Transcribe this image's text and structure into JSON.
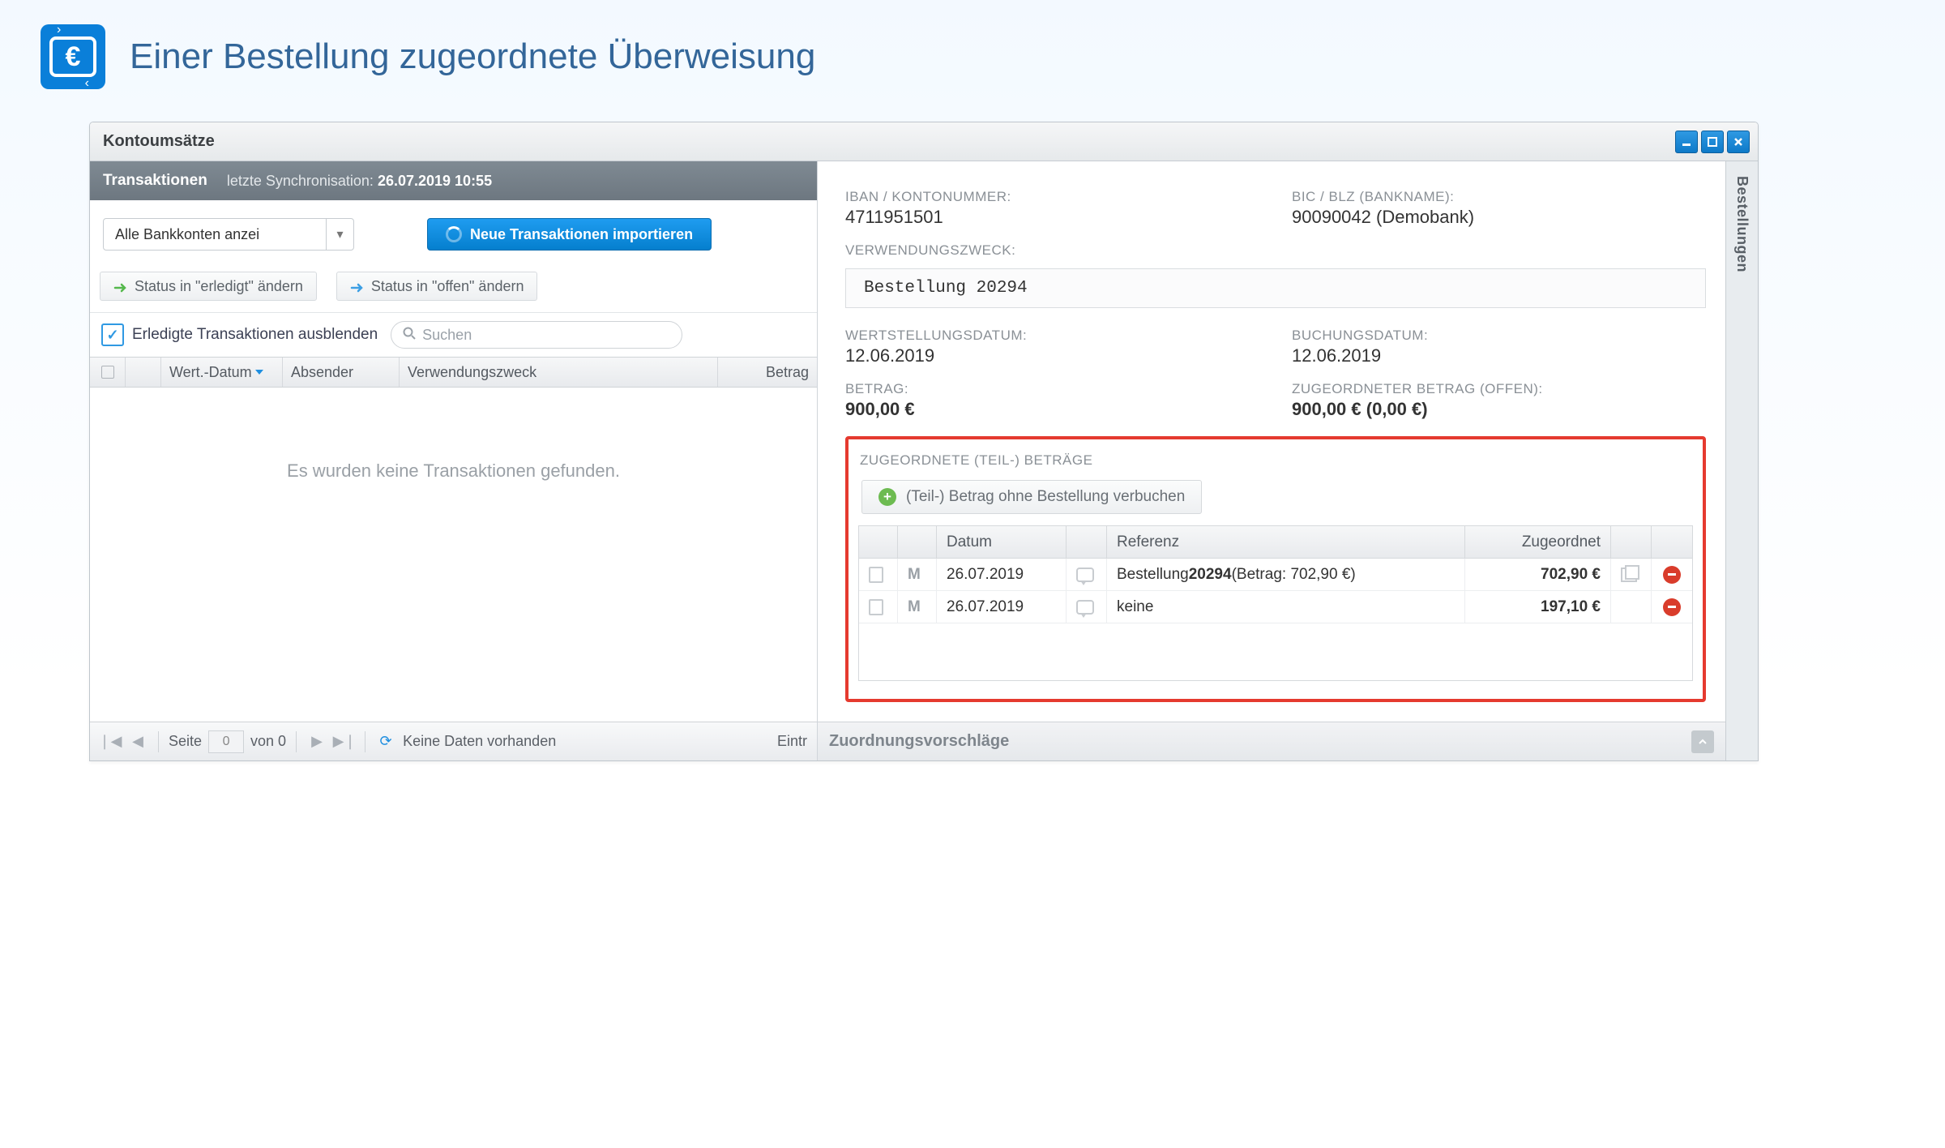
{
  "page": {
    "title": "Einer Bestellung zugeordnete Überweisung"
  },
  "window": {
    "title": "Kontoumsätze",
    "side_panel_label": "Bestellungen"
  },
  "left": {
    "subheader_title": "Transaktionen",
    "sync_prefix": "letzte Synchronisation:",
    "sync_time": "26.07.2019 10:55",
    "account_select": "Alle Bankkonten anzei",
    "import_btn": "Neue Transaktionen importieren",
    "status_done": "Status in \"erledigt\" ändern",
    "status_open": "Status in \"offen\" ändern",
    "hide_done_label": "Erledigte Transaktionen ausblenden",
    "search_placeholder": "Suchen",
    "columns": {
      "date": "Wert.-Datum",
      "sender": "Absender",
      "purpose": "Verwendungszweck",
      "amount": "Betrag"
    },
    "empty_text": "Es wurden keine Transaktionen gefunden.",
    "pager": {
      "page_label": "Seite",
      "page_value": "0",
      "of_label": "von 0",
      "no_data": "Keine Daten vorhanden",
      "entries": "Eintr"
    }
  },
  "details": {
    "holder_cutoff": "",
    "iban_label": "IBAN / KONTONUMMER:",
    "iban_value": "4711951501",
    "bic_label": "BIC / BLZ (BANKNAME):",
    "bic_value": "90090042 (Demobank)",
    "purpose_label": "VERWENDUNGSZWECK:",
    "purpose_text": "Bestellung 20294",
    "value_date_label": "WERTSTELLUNGSDATUM:",
    "value_date": "12.06.2019",
    "booking_date_label": "BUCHUNGSDATUM:",
    "booking_date": "12.06.2019",
    "amount_label": "BETRAG:",
    "amount_value": "900,00 €",
    "assigned_label": "ZUGEORDNETER BETRAG (OFFEN):",
    "assigned_value": "900,00 € (0,00 €)"
  },
  "assigned": {
    "section_title": "ZUGEORDNETE (TEIL-) BETRÄGE",
    "add_btn": "(Teil-) Betrag ohne Bestellung verbuchen",
    "columns": {
      "date": "Datum",
      "ref": "Referenz",
      "amount": "Zugeordnet"
    },
    "rows": [
      {
        "date": "26.07.2019",
        "ref_prefix": "Bestellung ",
        "ref_bold": "20294",
        "ref_suffix": " (Betrag: 702,90 €)",
        "amount": "702,90 €",
        "has_copy": true
      },
      {
        "date": "26.07.2019",
        "ref_prefix": "keine",
        "ref_bold": "",
        "ref_suffix": "",
        "amount": "197,10 €",
        "has_copy": false
      }
    ]
  },
  "suggestions": {
    "title": "Zuordnungsvorschläge"
  }
}
